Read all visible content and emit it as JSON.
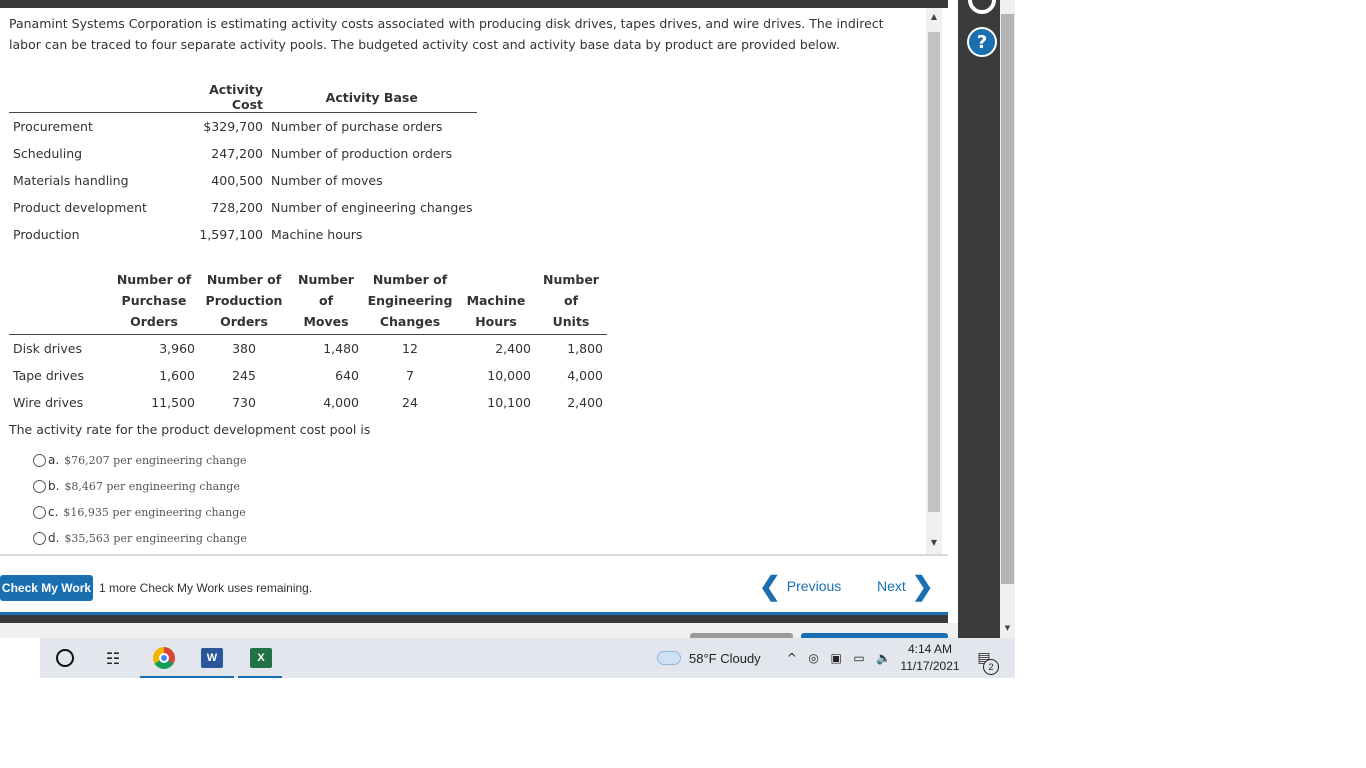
{
  "intro": "Panamint Systems Corporation is estimating activity costs associated with producing disk drives, tapes drives, and wire drives. The indirect labor can be traced to four separate activity pools. The budgeted activity cost and activity base data by product are provided below.",
  "table1": {
    "headers": [
      "",
      "Activity Cost",
      "Activity Base"
    ],
    "rows": [
      {
        "pool": "Procurement",
        "cost": "$329,700",
        "base": "Number of purchase orders"
      },
      {
        "pool": "Scheduling",
        "cost": "247,200",
        "base": "Number of production orders"
      },
      {
        "pool": "Materials handling",
        "cost": "400,500",
        "base": "Number of moves"
      },
      {
        "pool": "Product development",
        "cost": "728,200",
        "base": "Number of engineering changes"
      },
      {
        "pool": "Production",
        "cost": "1,597,100",
        "base": "Machine hours"
      }
    ]
  },
  "table2": {
    "headers": [
      [
        "Number of",
        "Purchase",
        "Orders"
      ],
      [
        "Number of",
        "Production",
        "Orders"
      ],
      [
        "Number",
        "of",
        "Moves"
      ],
      [
        "Number of",
        "Engineering",
        "Changes"
      ],
      [
        "Machine",
        "Hours"
      ],
      [
        "Number",
        "of",
        "Units"
      ]
    ],
    "rows": [
      {
        "product": "Disk drives",
        "values": [
          "3,960",
          "380",
          "1,480",
          "12",
          "2,400",
          "1,800"
        ]
      },
      {
        "product": "Tape drives",
        "values": [
          "1,600",
          "245",
          "640",
          "7",
          "10,000",
          "4,000"
        ]
      },
      {
        "product": "Wire drives",
        "values": [
          "11,500",
          "730",
          "4,000",
          "24",
          "10,100",
          "2,400"
        ]
      }
    ]
  },
  "question": "The activity rate for the product development cost pool is",
  "options": [
    {
      "letter": "a.",
      "text": "$76,207 per engineering change"
    },
    {
      "letter": "b.",
      "text": "$8,467 per engineering change"
    },
    {
      "letter": "c.",
      "text": "$16,935 per engineering change"
    },
    {
      "letter": "d.",
      "text": "$35,563 per engineering change"
    }
  ],
  "footer": {
    "check_label": "Check My Work",
    "check_note": "1 more Check My Work uses remaining.",
    "previous_label": "Previous",
    "next_label": "Next"
  },
  "help_label": "?",
  "taskbar": {
    "word_label": "W",
    "excel_label": "X",
    "weather": "58°F  Cloudy",
    "time": "4:14 AM",
    "date": "11/17/2021",
    "notification_count": "2"
  },
  "colors": {
    "accent": "#1a6fb0",
    "panel": "#3b3b3b"
  }
}
